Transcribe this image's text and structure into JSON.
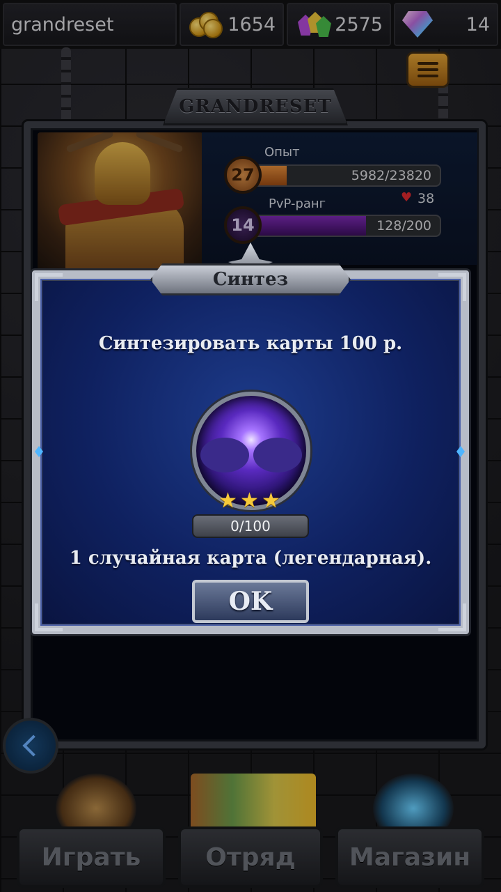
{
  "topbar": {
    "username": "grandreset",
    "gold": "1654",
    "crystals": "2575",
    "diamonds": "14",
    "icons": [
      "coin-stack-icon",
      "crystal-cluster-icon",
      "diamond-icon",
      "menu-icon"
    ]
  },
  "profile": {
    "title": "GRANDRESET",
    "exp_label": "Опыт",
    "level": "27",
    "exp_value": "5982/23820",
    "exp_progress": 0.251,
    "pvp_label": "PvP-ранг",
    "pvp_rank": "14",
    "pvp_value": "128/200",
    "pvp_progress": 0.64,
    "hearts": "38"
  },
  "dialog": {
    "title": "Синтез",
    "prompt": "Синтезировать карты 100 р.",
    "progress": "0/100",
    "stars": 3,
    "reward": "1 случайная карта (легендарная).",
    "ok_label": "OK"
  },
  "nav": {
    "play": "Играть",
    "squad": "Отряд",
    "shop": "Магазин"
  },
  "colors": {
    "dialog_bg": "#0f2160",
    "exp_fill": "#c8671f",
    "pvp_fill": "#5a1a8a",
    "gold": "#f6c93a"
  }
}
